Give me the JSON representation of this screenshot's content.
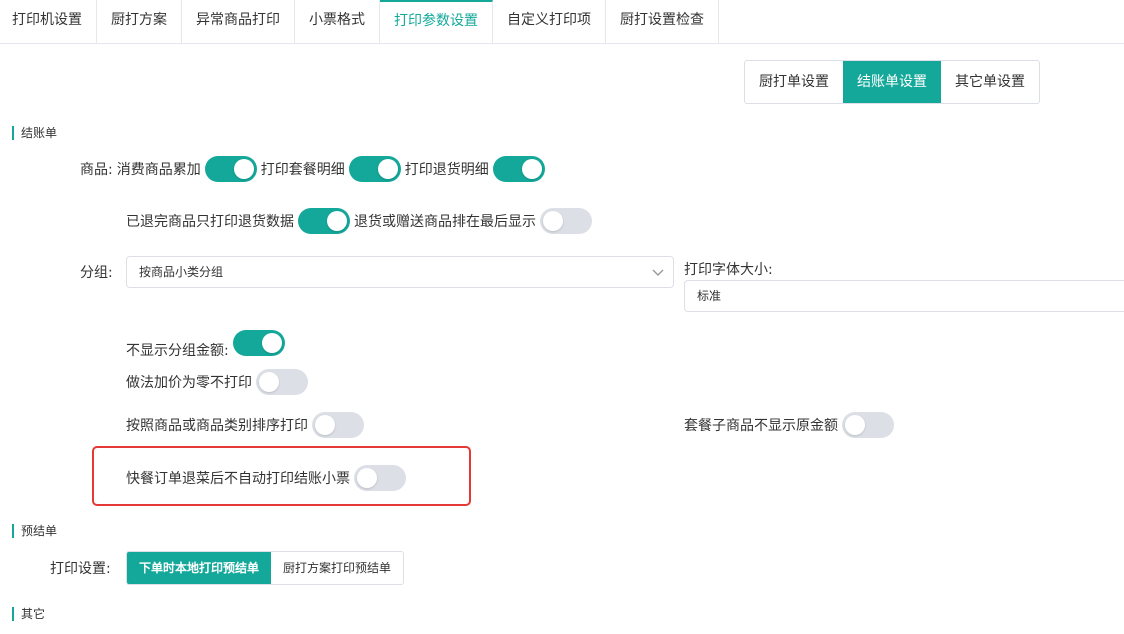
{
  "tabs": [
    {
      "label": "打印机设置",
      "active": false
    },
    {
      "label": "厨打方案",
      "active": false
    },
    {
      "label": "异常商品打印",
      "active": false
    },
    {
      "label": "小票格式",
      "active": false
    },
    {
      "label": "打印参数设置",
      "active": true
    },
    {
      "label": "自定义打印项",
      "active": false
    },
    {
      "label": "厨打设置检查",
      "active": false
    }
  ],
  "subtabs": {
    "kitchen": "厨打单设置",
    "checkout": "结账单设置",
    "other": "其它单设置",
    "active": "checkout"
  },
  "sections": {
    "checkout": "结账单",
    "prebill": "预结单",
    "other": "其它"
  },
  "goods": {
    "label": "商品:",
    "accumulate": {
      "label": "消费商品累加",
      "on": true
    },
    "combo_detail": {
      "label": "打印套餐明细",
      "on": true
    },
    "return_detail": {
      "label": "打印退货明细",
      "on": true
    },
    "returned_only": {
      "label": "已退完商品只打印退货数据",
      "on": true
    },
    "return_last": {
      "label": "退货或赠送商品排在最后显示",
      "on": false
    }
  },
  "group": {
    "label": "分组:",
    "value": "按商品小类分组",
    "font_size_label": "打印字体大小:",
    "font_size_value": "标准"
  },
  "options": {
    "hide_group_amount": {
      "label": "不显示分组金额:",
      "on": true
    },
    "zero_price_no_print": {
      "label": "做法加价为零不打印",
      "on": false
    },
    "sort_by_category": {
      "label": "按照商品或商品类别排序打印",
      "on": false
    },
    "combo_child_no_price": {
      "label": "套餐子商品不显示原金额",
      "on": false
    },
    "fast_food_no_auto_print": {
      "label": "快餐订单退菜后不自动打印结账小票",
      "on": false
    }
  },
  "prebill": {
    "label": "打印设置:",
    "local": "下单时本地打印预结单",
    "kitchen": "厨打方案打印预结单",
    "active": "local"
  },
  "colors": {
    "accent": "#14a89a",
    "highlight": "#e53935",
    "switch_off": "#dcdfe6"
  }
}
